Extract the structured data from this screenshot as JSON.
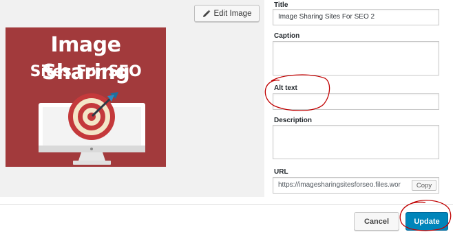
{
  "toolbar": {
    "edit_image_label": "Edit Image"
  },
  "thumbnail": {
    "line1": "Image Sharing",
    "line2": "Sites For SEO",
    "background_color": "#a23a3c"
  },
  "fields": {
    "title": {
      "label": "Title",
      "value": "Image Sharing Sites For SEO 2"
    },
    "caption": {
      "label": "Caption",
      "value": ""
    },
    "alt_text": {
      "label": "Alt text",
      "value": ""
    },
    "description": {
      "label": "Description",
      "value": ""
    },
    "url": {
      "label": "URL",
      "value": "https://imagesharingsitesforseo.files.wor",
      "copy_label": "Copy"
    }
  },
  "footer": {
    "cancel_label": "Cancel",
    "update_label": "Update"
  },
  "colors": {
    "primary": "#0085ba",
    "annotation": "#c00000"
  },
  "icons": {
    "edit": "pencil-icon",
    "resize": "resize-grip-icon"
  }
}
